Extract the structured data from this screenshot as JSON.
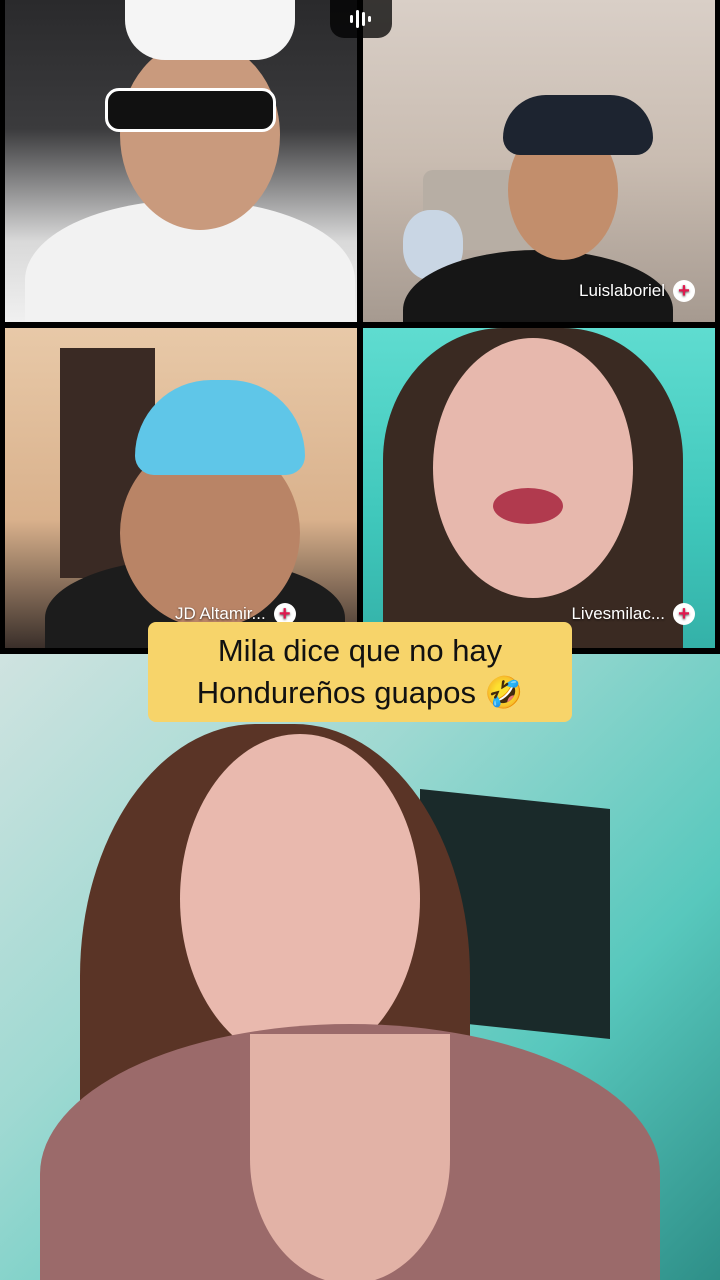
{
  "participants": [
    {
      "name": ""
    },
    {
      "name": "Luislaboriel"
    },
    {
      "name": "JD Altamir..."
    },
    {
      "name": "Livesmilac..."
    },
    {
      "name": ""
    }
  ],
  "caption": {
    "line1": "Mila dice que no hay",
    "line2": "Hondureños guapos 🤣"
  },
  "icons": {
    "audio": "audio-waveform-icon",
    "follow": "plus-circle-icon"
  },
  "colors": {
    "caption_bg": "#f7d46a",
    "follow_plus": "#e0184e"
  }
}
